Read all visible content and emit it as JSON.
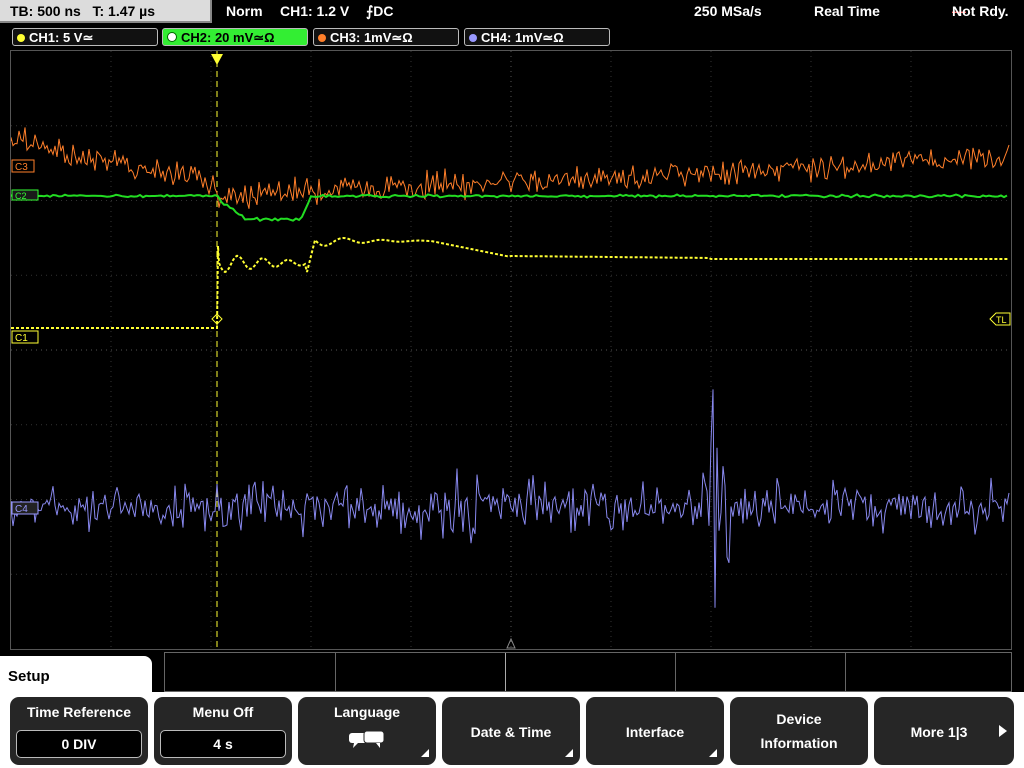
{
  "top": {
    "timebase": "TB: 500 ns",
    "trigger_time": "T: 1.47 µs",
    "trigger_mode": "Norm",
    "trigger_setting": "CH1: 1.2 V",
    "trigger_slope": "⨍DC",
    "sample_rate": "250 MSa/s",
    "acq_mode": "Real Time",
    "status": "Not Rdy."
  },
  "channels": [
    {
      "label": "CH1: 5 V≃",
      "color": "#ffff33"
    },
    {
      "label": "CH2: 20 mV≃Ω",
      "color": "#33ff33"
    },
    {
      "label": "CH3: 1mV≃Ω",
      "color": "#ff7f2a"
    },
    {
      "label": "CH4: 1mV≃Ω",
      "color": "#9999ff"
    }
  ],
  "markers": {
    "ch1": "C1",
    "ch2": "C2",
    "ch3": "C3",
    "ch4": "C4",
    "trigger_level": "TL"
  },
  "menu": {
    "title": "Setup",
    "time_reference": {
      "label": "Time Reference",
      "value": "0 DIV"
    },
    "menu_off": {
      "label": "Menu Off",
      "value": "4 s"
    },
    "language": {
      "label": "Language",
      "icon": "speech-bubbles-icon"
    },
    "date_time": {
      "label": "Date & Time"
    },
    "interface": {
      "label": "Interface"
    },
    "device_info": {
      "line1": "Device",
      "line2": "Information"
    },
    "more": {
      "label": "More 1|3"
    }
  },
  "colors": {
    "ch1": "#ffff33",
    "ch2": "#33ff33",
    "ch3": "#ff7f2a",
    "ch4": "#9999ff"
  }
}
